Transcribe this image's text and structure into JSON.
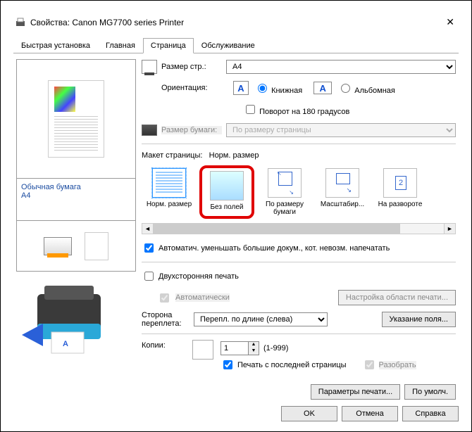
{
  "window": {
    "title": "Свойства: Canon MG7700 series Printer"
  },
  "tabs": [
    "Быстрая установка",
    "Главная",
    "Страница",
    "Обслуживание"
  ],
  "activeTab": 2,
  "preview": {
    "paperType": "Обычная бумага",
    "paperSize": "A4"
  },
  "pageSize": {
    "label": "Размер стр.:",
    "value": "A4"
  },
  "orientation": {
    "label": "Ориентация:",
    "portrait": "Книжная",
    "landscape": "Альбомная",
    "rotate": "Поворот на 180 градусов"
  },
  "paperOutput": {
    "label": "Размер бумаги:",
    "value": "По размеру страницы"
  },
  "layout": {
    "label": "Макет страницы:",
    "current": "Норм. размер",
    "items": [
      {
        "label": "Норм. размер"
      },
      {
        "label": "Без полей"
      },
      {
        "label": "По размеру бумаги"
      },
      {
        "label": "Масштабир..."
      },
      {
        "label": "На развороте"
      }
    ]
  },
  "autoReduce": "Автоматич. уменьшать большие докум., кот. невозм. напечатать",
  "duplex": {
    "label": "Двухсторонняя печать",
    "auto": "Автоматически",
    "areaBtn": "Настройка области печати..."
  },
  "binding": {
    "label": "Сторона переплета:",
    "value": "Перепл. по длине (слева)",
    "marginBtn": "Указание поля..."
  },
  "copies": {
    "label": "Копии:",
    "value": "1",
    "range": "(1-999)",
    "reverse": "Печать с последней страницы",
    "collate": "Разобрать"
  },
  "buttons": {
    "printParams": "Параметры печати...",
    "defaults": "По умолч.",
    "ok": "OK",
    "cancel": "Отмена",
    "help": "Справка"
  }
}
